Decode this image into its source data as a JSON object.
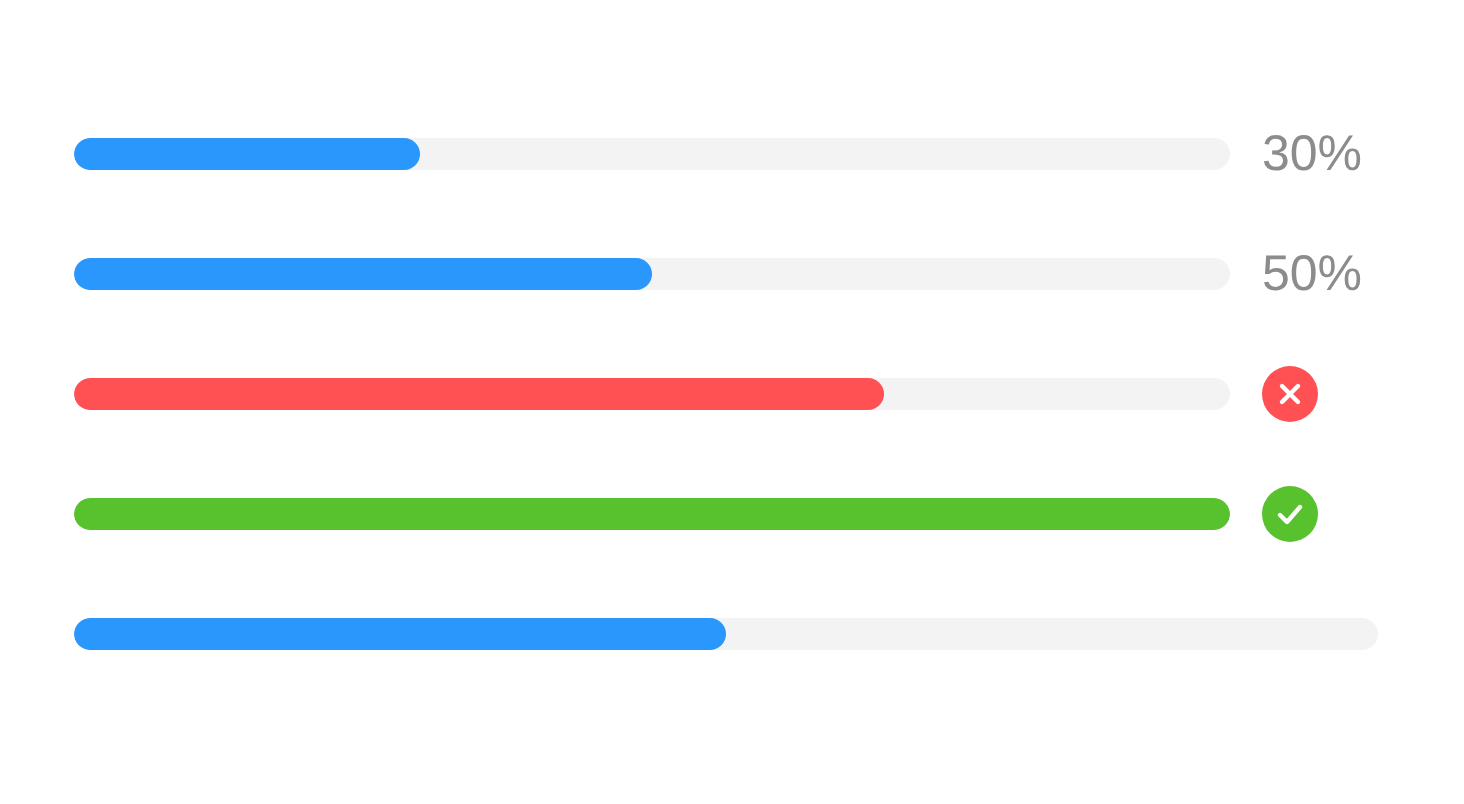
{
  "progress_bars": [
    {
      "kind": "percent",
      "color": "#2997fb",
      "level": 0.3,
      "reading": "30%"
    },
    {
      "kind": "percent",
      "color": "#2997fb",
      "level": 0.5,
      "reading": "50%"
    },
    {
      "kind": "error",
      "color": "#ff5153",
      "level": 0.7
    },
    {
      "kind": "success",
      "color": "#57c12e",
      "level": 1
    },
    {
      "kind": "none",
      "color": "#2997fb",
      "level": 0.5
    }
  ]
}
